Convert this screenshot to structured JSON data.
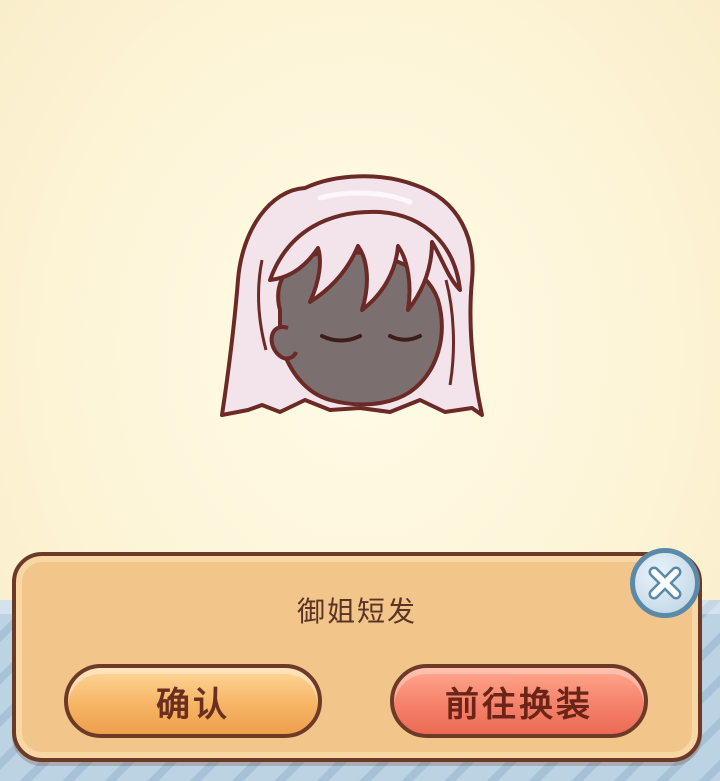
{
  "item": {
    "name": "御姐短发",
    "icon": "short-hair-icon"
  },
  "dialog": {
    "confirm_label": "确认",
    "goto_label": "前往换装",
    "close_icon": "close-icon"
  },
  "colors": {
    "panel": "#f2c58a",
    "outline": "#6e3a28",
    "confirm": "#f6b565",
    "goto": "#f5826a",
    "close_ring": "#5b89a8",
    "hair": "#f3e4ec"
  }
}
